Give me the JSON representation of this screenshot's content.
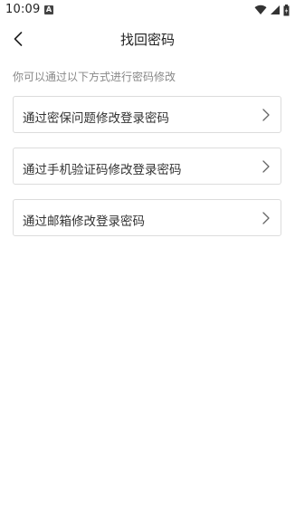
{
  "status_bar": {
    "time": "10:09",
    "notification_icon": "A",
    "icons": [
      "wifi-icon",
      "signal-icon",
      "battery-icon"
    ]
  },
  "header": {
    "title": "找回密码",
    "back_icon": "chevron-left-icon"
  },
  "hint": "你可以通过以下方式进行密码修改",
  "options": [
    {
      "label": "通过密保问题修改登录密码",
      "icon": "chevron-right-icon"
    },
    {
      "label": "通过手机验证码修改登录密码",
      "icon": "chevron-right-icon"
    },
    {
      "label": "通过邮箱修改登录密码",
      "icon": "chevron-right-icon"
    }
  ],
  "colors": {
    "background": "#ffffff",
    "text_primary": "#222222",
    "text_hint": "#888888",
    "border": "#dcdcdc"
  }
}
